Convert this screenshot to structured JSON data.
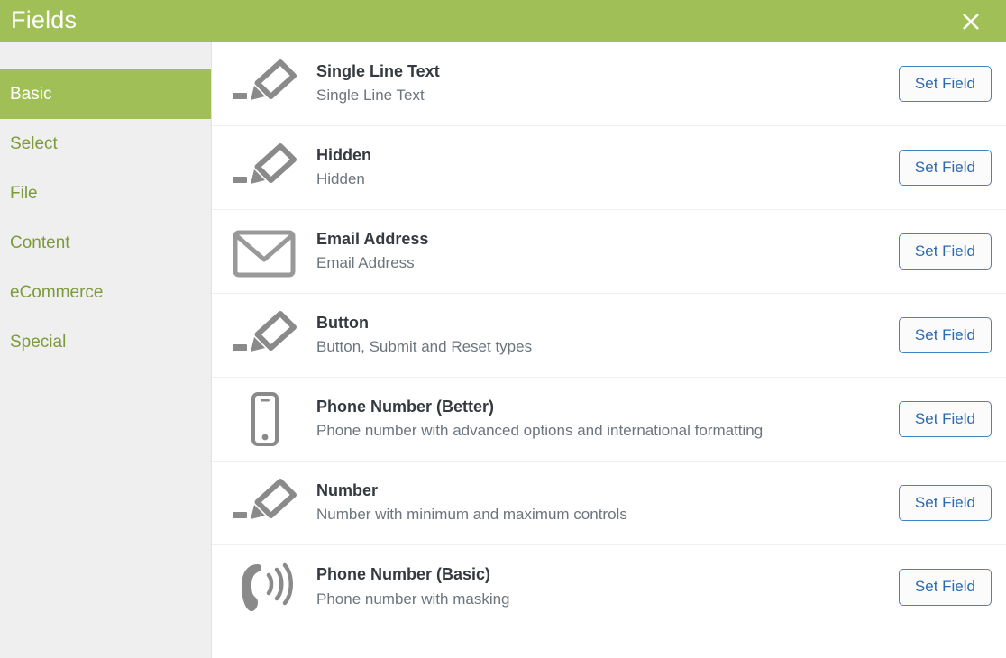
{
  "header": {
    "title": "Fields",
    "close_icon": "close-icon"
  },
  "colors": {
    "brand_green": "#a0c057",
    "sidebar_bg": "#efefef",
    "sidebar_text": "#7d9b3a",
    "title_text": "#343a40",
    "desc_text": "#6c757d",
    "button_border": "#4084c4",
    "button_text": "#2a6ab0"
  },
  "sidebar": {
    "items": [
      {
        "label": "Basic",
        "active": true
      },
      {
        "label": "Select",
        "active": false
      },
      {
        "label": "File",
        "active": false
      },
      {
        "label": "Content",
        "active": false
      },
      {
        "label": "eCommerce",
        "active": false
      },
      {
        "label": "Special",
        "active": false
      }
    ]
  },
  "main": {
    "action_label": "Set Field",
    "fields": [
      {
        "title": "Single Line Text",
        "description": "Single Line Text",
        "icon": "pencil-icon",
        "action": "Set Field"
      },
      {
        "title": "Hidden",
        "description": "Hidden",
        "icon": "pencil-icon",
        "action": "Set Field"
      },
      {
        "title": "Email Address",
        "description": "Email Address",
        "icon": "envelope-icon",
        "action": "Set Field"
      },
      {
        "title": "Button",
        "description": "Button, Submit and Reset types",
        "icon": "pencil-icon",
        "action": "Set Field"
      },
      {
        "title": "Phone Number (Better)",
        "description": "Phone number with advanced options and international formatting",
        "icon": "mobile-phone-icon",
        "action": "Set Field"
      },
      {
        "title": "Number",
        "description": "Number with minimum and maximum controls",
        "icon": "pencil-icon",
        "action": "Set Field"
      },
      {
        "title": "Phone Number (Basic)",
        "description": "Phone number with masking",
        "icon": "phone-ringing-icon",
        "action": "Set Field"
      }
    ]
  }
}
